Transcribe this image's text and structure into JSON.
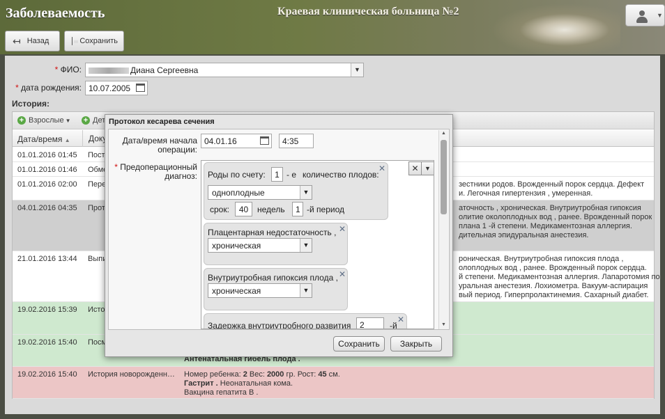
{
  "app": {
    "title": "Заболеваемость",
    "hospital": "Краевая клиническая больница №2"
  },
  "toolbar": {
    "back_label": "Назад",
    "save_label": "Сохранить"
  },
  "form": {
    "fio_label": "ФИО:",
    "fio_value": "Диана Сергеевна",
    "birth_label": "дата рождения:",
    "birth_value": "10.07.2005",
    "history_label": "История:"
  },
  "grid": {
    "toolbar": {
      "adults": "Взрослые",
      "children": "Дет"
    },
    "columns": [
      "Дата/время",
      "Доку"
    ],
    "rows": [
      {
        "dt": "01.01.2016 01:45",
        "doc": "Пост",
        "det": []
      },
      {
        "dt": "01.01.2016 01:46",
        "doc": "Обме",
        "det": []
      },
      {
        "dt": "01.01.2016 02:00",
        "doc": "Пере",
        "det": [
          "зестники родов. Врожденный порок сердца. Дефект",
          "и. Легочная гипертензия , умеренная."
        ]
      },
      {
        "dt": "04.01.2016 04:35",
        "doc": "Прот",
        "det": [
          "аточность , хроническая. Внутриутробная гипоксия",
          "олитие околоплодных вод , ранее. Врожденный порок",
          "плана 1 -й степени. Медикаментозная аллергия.",
          "дительная эпидуральная анестезия."
        ]
      },
      {
        "dt": "21.01.2016 13:44",
        "doc": "Выпи",
        "det": [
          "роническая. Внутриутробная гипоксия плода ,",
          "олоплодных вод , ранее. Врожденный порок сердца.",
          "й степени. Медикаментозная аллергия. Лапаротомия по",
          "уральная анестезия. Лохиометра. Вакуум-аспирация",
          "вый период. Гиперпролактинемия. Сахарный диабет."
        ]
      },
      {
        "dt": "19.02.2016 15:39",
        "doc": "Исто",
        "det": []
      },
      {
        "dt": "19.02.2016 15:40",
        "doc": "Посм",
        "det": [
          "Антенатальная гибель плода ."
        ]
      },
      {
        "dt": "19.02.2016 15:40",
        "doc": "История новорожденн…",
        "det": []
      }
    ],
    "last_row": {
      "line1_prefix": "Номер ребенка: ",
      "child_no": "2",
      "weight_label": " Вес: ",
      "weight": "2000",
      "weight_unit": " гр. Рост: ",
      "height": "45",
      "height_unit": " см.",
      "line2_bold": "Гастрит .",
      "line2_rest": " Неонатальная кома.",
      "line3": "Вакцина гепатита В ."
    }
  },
  "modal": {
    "title": "Протокол кесарева сечения",
    "start_label": "Дата/время начала операции:",
    "start_date": "04.01.16",
    "start_time": "4:35",
    "diag_label": "Предоперационный диагноз:",
    "card1": {
      "births_label": "Роды по счету:",
      "births_value": "1",
      "e_label": "- е",
      "fetus_label": "количество плодов:",
      "fetus_value": "одноплодные",
      "term_label": "срок:",
      "term_value": "40",
      "weeks_label": "недель",
      "period_value": "1",
      "period_label": "-й период"
    },
    "card2": {
      "title": "Плацентарная недостаточность ,",
      "value": "хроническая"
    },
    "card3": {
      "title": "Внутриутробная гипоксия плода ,",
      "value": "хроническая"
    },
    "card4": {
      "title": "Задержка внутриутробного развития",
      "value": "2",
      "suffix": "-й"
    },
    "save_label": "Сохранить",
    "close_label": "Закрыть"
  },
  "colors": {
    "row_green": "#cfe9cf",
    "row_red": "#ecc6c6",
    "row_selected": "#cfcfcf"
  }
}
